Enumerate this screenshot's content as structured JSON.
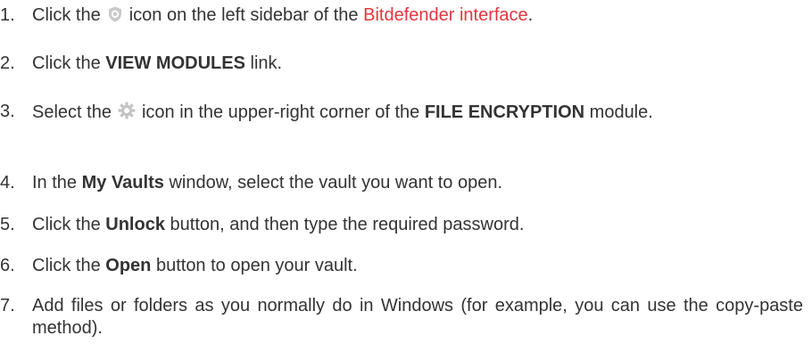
{
  "steps": [
    {
      "number": "1.",
      "t1": "Click the",
      "icon": "shield-icon",
      "t2": "icon on the left sidebar of the",
      "link": "Bitdefender interface",
      "t3": "."
    },
    {
      "number": "2.",
      "t1": "Click the",
      "bold": "VIEW MODULES",
      "t2": "link."
    },
    {
      "number": "3.",
      "t1": "Select the",
      "icon": "gear-icon",
      "t2": "icon in the upper-right corner of the",
      "bold": "FILE ENCRYPTION",
      "t3": "module."
    },
    {
      "number": "4.",
      "t1": "In the",
      "bold": "My Vaults",
      "t2": "window, select the vault you want to open."
    },
    {
      "number": "5.",
      "t1": "Click the",
      "bold": "Unlock",
      "t2": "button, and then type the required password."
    },
    {
      "number": "6.",
      "t1": "Click the",
      "bold": "Open",
      "t2": "button to open your vault."
    },
    {
      "number": "7.",
      "t1": "Add files or folders as you normally do in Windows (for example, you can use the copy-paste method)."
    }
  ],
  "colors": {
    "text": "#333333",
    "link": "#e5343d",
    "icon": "#b8b8b8"
  }
}
